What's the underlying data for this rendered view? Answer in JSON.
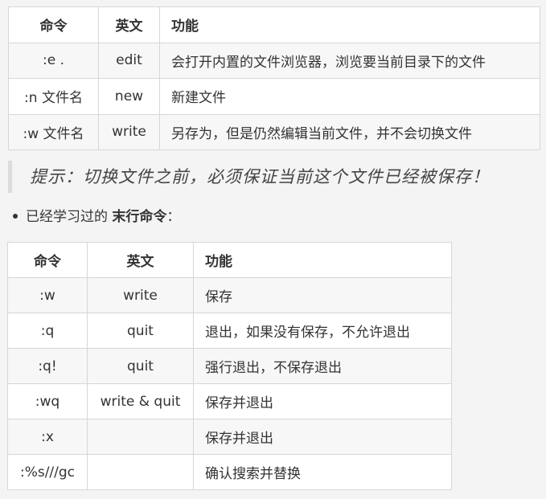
{
  "table1": {
    "headers": [
      "命令",
      "英文",
      "功能"
    ],
    "rows": [
      [
        ":e .",
        "edit",
        "会打开内置的文件浏览器，浏览要当前目录下的文件"
      ],
      [
        ":n 文件名",
        "new",
        "新建文件"
      ],
      [
        ":w 文件名",
        "write",
        "另存为，但是仍然编辑当前文件，并不会切换文件"
      ]
    ]
  },
  "tip": "提示：切换文件之前，必须保证当前这个文件已经被保存！",
  "bullet": {
    "prefix": "已经学习过的 ",
    "bold": "末行命令",
    "suffix": "："
  },
  "table2": {
    "headers": [
      "命令",
      "英文",
      "功能"
    ],
    "rows": [
      [
        ":w",
        "write",
        "保存"
      ],
      [
        ":q",
        "quit",
        "退出，如果没有保存，不允许退出"
      ],
      [
        ":q!",
        "quit",
        "强行退出，不保存退出"
      ],
      [
        ":wq",
        "write & quit",
        "保存并退出"
      ],
      [
        ":x",
        "",
        "保存并退出"
      ],
      [
        ":%s///gc",
        "",
        "确认搜索并替换"
      ]
    ]
  }
}
